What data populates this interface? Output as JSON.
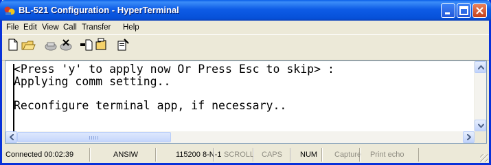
{
  "window": {
    "title": "BL-521 Configuration - HyperTerminal"
  },
  "menu": {
    "items": [
      {
        "label": "File"
      },
      {
        "label": "Edit"
      },
      {
        "label": "View"
      },
      {
        "label": "Call"
      },
      {
        "label": "Transfer"
      },
      {
        "label": "Help"
      }
    ]
  },
  "toolbar": {
    "buttons": [
      "new-icon",
      "open-icon",
      "connect-icon",
      "disconnect-icon",
      "send-icon",
      "receive-icon",
      "properties-icon"
    ]
  },
  "terminal": {
    "lines": [
      "<Press 'y' to apply now Or Press Esc to skip> :",
      "Applying comm setting..",
      "",
      "Reconfigure terminal app, if necessary.."
    ]
  },
  "status": {
    "connected": "Connected 00:02:39",
    "emulation": "ANSIW",
    "port": "115200 8-N-1",
    "scroll": "SCROLL",
    "caps": "CAPS",
    "num": "NUM",
    "capture": "Capture",
    "print_echo": "Print echo"
  },
  "colors": {
    "titlebar": "#0a5ee8",
    "close_button": "#c4401a",
    "chrome": "#ece9d8"
  }
}
